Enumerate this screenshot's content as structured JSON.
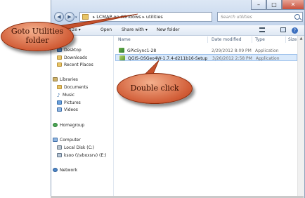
{
  "window": {
    "address": {
      "segments": [
        "LCMAP on Windows",
        "utilities"
      ]
    },
    "search": {
      "placeholder": "Search utilities"
    },
    "controls": {
      "minimize": "–",
      "maximize": "□",
      "close": "✕"
    }
  },
  "toolbar": {
    "organize_label": "Organize ▾",
    "open_label": "Open",
    "share_label": "Share with ▾",
    "new_folder_label": "New folder",
    "help_label": "?"
  },
  "nav": {
    "favorites": [
      "Desktop",
      "Downloads",
      "Recent Places"
    ],
    "libraries_label": "Libraries",
    "libraries": [
      "Documents",
      "Music",
      "Pictures",
      "Videos"
    ],
    "homegroup_label": "Homegroup",
    "computer_label": "Computer",
    "drives": [
      "Local Disk (C:)",
      "ksoo (\\\\vboxsrv) (E:)"
    ],
    "network_label": "Network"
  },
  "files": {
    "columns": {
      "name": "Name",
      "date": "Date modified",
      "type": "Type",
      "size": "Size"
    },
    "rows": [
      {
        "name": "GPicSync1-28",
        "date": "2/29/2012 8:09 PM",
        "type": "Application",
        "icon": "gpicsync-app-icon",
        "selected": false
      },
      {
        "name": "QGIS-OSGeo4W-1.7.4-d211b16-Setup",
        "date": "3/26/2012 2:58 PM",
        "type": "Application",
        "icon": "qgis-installer-icon",
        "selected": true
      }
    ]
  },
  "callouts": {
    "goto_line1": "Goto Utilities",
    "goto_line2": "folder",
    "double_click": "Double click"
  },
  "colors": {
    "callout_fill": "#d15c36",
    "selection": "#d9e9fb",
    "titlebar": "#c4d5ec"
  }
}
